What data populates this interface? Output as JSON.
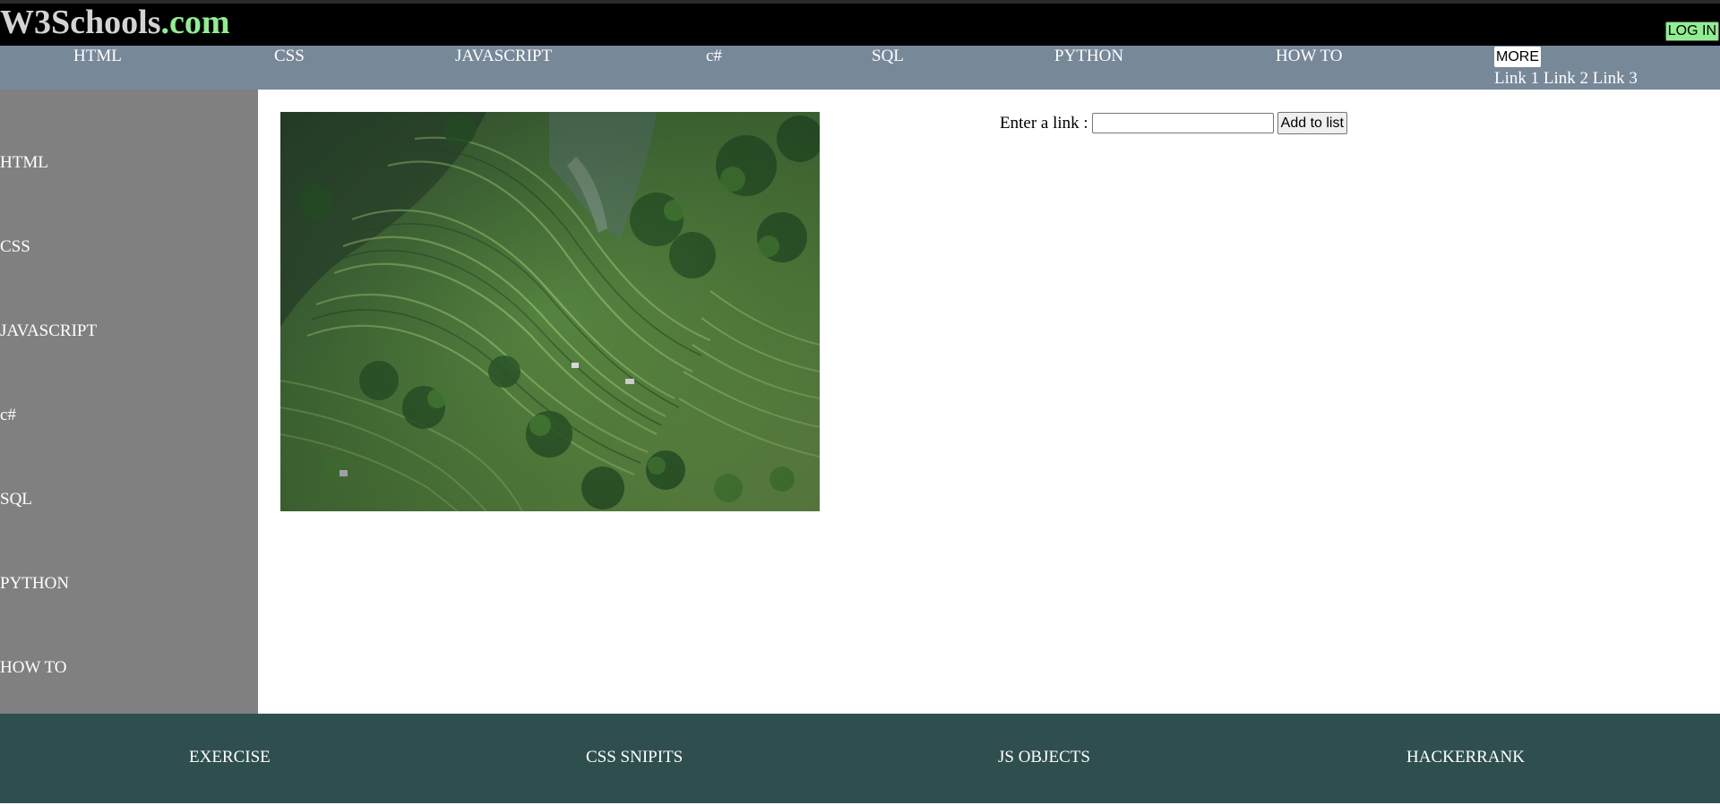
{
  "header": {
    "logo_main": "W3Schools",
    "logo_accent": ".com",
    "login_label": "LOG IN"
  },
  "topnav": {
    "items": [
      "HTML",
      "CSS",
      "JAVASCRIPT",
      "c#",
      "SQL",
      "PYTHON",
      "HOW TO"
    ],
    "more_label": "MORE",
    "more_links": [
      "Link 1",
      "Link 2",
      "Link 3"
    ]
  },
  "sidebar": {
    "items": [
      "HTML",
      "CSS",
      "JAVASCRIPT",
      "c#",
      "SQL",
      "PYTHON",
      "HOW TO"
    ]
  },
  "main": {
    "image_subject": "aerial view of green terraced rice fields",
    "link_label": "Enter a link :",
    "link_value": "",
    "add_button_label": "Add to list"
  },
  "footer": {
    "items": [
      "EXERCISE",
      "CSS SNIPITS",
      "JS OBJECTS",
      "HACKERRANK"
    ]
  },
  "colors": {
    "header_bg": "#000000",
    "logo_text": "#d3d3d3",
    "logo_accent": "#90ee90",
    "login_bg": "#90ee90",
    "topnav_bg": "#778899",
    "sidebar_bg": "#808080",
    "footer_bg": "#2f4f4f"
  }
}
